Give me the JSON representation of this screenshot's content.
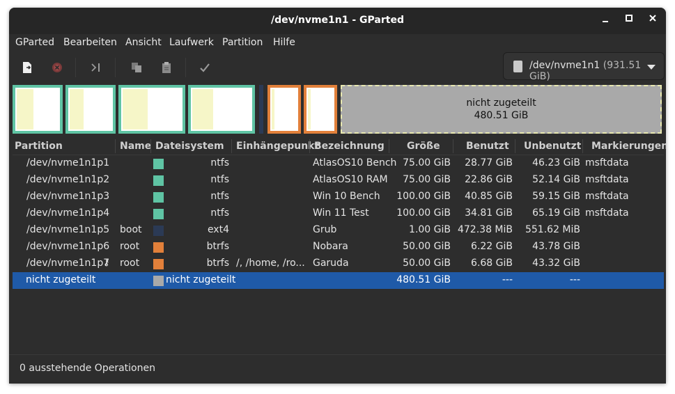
{
  "window": {
    "title": "/dev/nvme1n1 - GParted"
  },
  "menu": [
    "GParted",
    "Bearbeiten",
    "Ansicht",
    "Laufwerk",
    "Partition",
    "Hilfe"
  ],
  "toolbar": {
    "icons": [
      "new-partition-icon",
      "delete-partition-icon",
      "resize-move-icon",
      "copy-icon",
      "paste-icon",
      "apply-icon"
    ]
  },
  "device": {
    "name": "/dev/nvme1n1",
    "size": "(931.51 GiB)"
  },
  "diskmap": {
    "unallocated_label": "nicht zugeteilt",
    "unallocated_size": "480.51 GiB"
  },
  "table": {
    "headers": [
      "Partition",
      "Name",
      "Dateisystem",
      "Einhängepunkt",
      "Bezeichnung",
      "Größe",
      "Benutzt",
      "Unbenutzt",
      "Markierungen"
    ],
    "rows": [
      {
        "partition": "/dev/nvme1n1p1",
        "name": "",
        "fs": "ntfs",
        "fs_color": "#5fc4a4",
        "mount": "",
        "label": "AtlasOS10 Bench",
        "size": "75.00 GiB",
        "used": "28.77 GiB",
        "unused": "46.23 GiB",
        "flags": "msftdata"
      },
      {
        "partition": "/dev/nvme1n1p2",
        "name": "",
        "fs": "ntfs",
        "fs_color": "#5fc4a4",
        "mount": "",
        "label": "AtlasOS10 RAM",
        "size": "75.00 GiB",
        "used": "22.86 GiB",
        "unused": "52.14 GiB",
        "flags": "msftdata"
      },
      {
        "partition": "/dev/nvme1n1p3",
        "name": "",
        "fs": "ntfs",
        "fs_color": "#5fc4a4",
        "mount": "",
        "label": "Win 10 Bench",
        "size": "100.00 GiB",
        "used": "40.85 GiB",
        "unused": "59.15 GiB",
        "flags": "msftdata"
      },
      {
        "partition": "/dev/nvme1n1p4",
        "name": "",
        "fs": "ntfs",
        "fs_color": "#5fc4a4",
        "mount": "",
        "label": "Win 11 Test",
        "size": "100.00 GiB",
        "used": "34.81 GiB",
        "unused": "65.19 GiB",
        "flags": "msftdata"
      },
      {
        "partition": "/dev/nvme1n1p5",
        "name": "boot",
        "fs": "ext4",
        "fs_color": "#2b3a55",
        "mount": "",
        "label": "Grub",
        "size": "1.00 GiB",
        "used": "472.38 MiB",
        "unused": "551.62 MiB",
        "flags": ""
      },
      {
        "partition": "/dev/nvme1n1p6",
        "name": "root",
        "fs": "btrfs",
        "fs_color": "#e2803a",
        "mount": "",
        "label": "Nobara",
        "size": "50.00 GiB",
        "used": "6.22 GiB",
        "unused": "43.78 GiB",
        "flags": ""
      },
      {
        "partition": "/dev/nvme1n1p7",
        "name": "root",
        "fs": "btrfs",
        "fs_color": "#e2803a",
        "mount": "/, /home, /ro...",
        "label": "Garuda",
        "size": "50.00 GiB",
        "used": "6.68 GiB",
        "unused": "43.32 GiB",
        "flags": ""
      },
      {
        "partition": "nicht zugeteilt",
        "name": "",
        "fs": "nicht zugeteilt",
        "fs_color": "#a9a9a9",
        "mount": "",
        "label": "",
        "size": "480.51 GiB",
        "used": "---",
        "unused": "---",
        "flags": ""
      }
    ]
  },
  "status": {
    "text": "0 ausstehende Operationen"
  }
}
